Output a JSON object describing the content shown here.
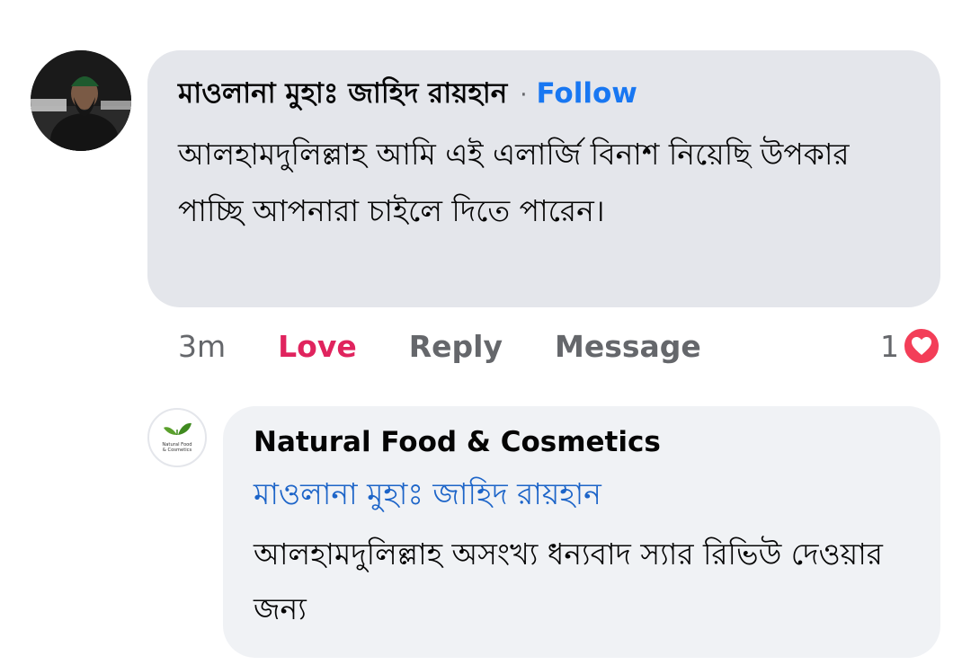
{
  "comment": {
    "author": "মাওলানা মুহাঃ জাহিদ রায়হান",
    "separator": "·",
    "follow_label": "Follow",
    "text": "আলহামদুলিল্লাহ আমি এই এলার্জি বিনাশ নিয়েছি উপকার পাচ্ছি  আপনারা চাইলে দিতে পারেন।",
    "time": "3m",
    "love_label": "Love",
    "reply_label": "Reply",
    "message_label": "Message",
    "reaction_count": "1",
    "reaction_icon": "heart-icon"
  },
  "reply": {
    "author": "Natural Food & Cosmetics",
    "mention": "মাওলানা মুহাঃ জাহিদ রায়হান",
    "text": "আলহামদুলিল্লাহ অসংখ্য ধন্যবাদ স্যার রিভিউ দেওয়ার জন্য",
    "avatar_logo_text": "Natural Food & Cosmetics"
  },
  "colors": {
    "accent": "#1877f2",
    "love": "#e0245e",
    "heart_badge": "#f33e58",
    "mention": "#1c64c8",
    "bubble": "#f0f2f5"
  }
}
